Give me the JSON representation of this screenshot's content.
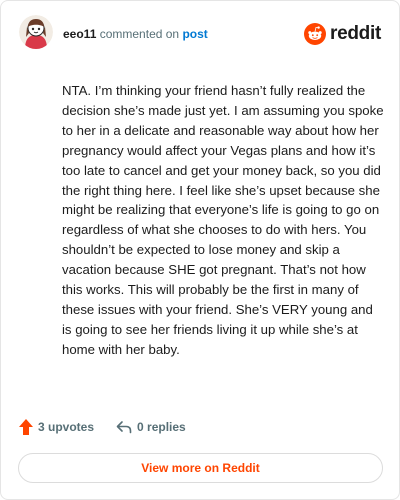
{
  "comment": {
    "username": "eeo11",
    "action_text": "commented on",
    "post_link_text": "post",
    "body": "NTA. I’m thinking your friend hasn’t fully realized the decision she’s made just yet. I am assuming you spoke to her in a delicate and reasonable way about how her pregnancy would affect your Vegas plans and how it’s too late to cancel and get your money back, so you did the right thing here. I feel like she’s upset because she might be realizing that everyone’s life is going to go on regardless of what she chooses to do with hers. You shouldn’t be expected to lose money and skip a vacation because SHE got pregnant. That’s not how this works. This will probably be the first in many of these issues with your friend. She’s VERY young and is going to see her friends living it up while she’s at home with her baby.",
    "upvotes": "3 upvotes",
    "replies": "0 replies"
  },
  "brand": {
    "name": "reddit",
    "accent": "#ff4500"
  },
  "footer": {
    "view_more_label": "View more on Reddit"
  },
  "icons": {
    "avatar": "snoo-avatar",
    "logo": "reddit-alien-icon",
    "upvote": "upvote-arrow-icon",
    "reply": "reply-arrow-icon"
  }
}
